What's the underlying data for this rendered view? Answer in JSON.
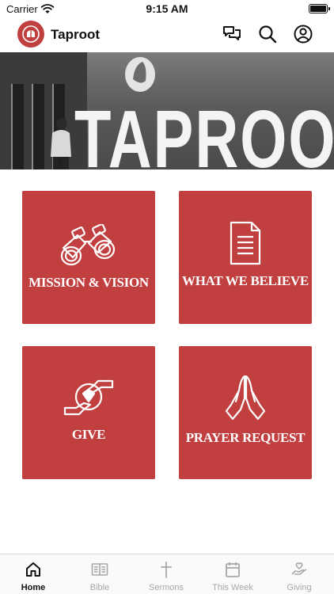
{
  "status_bar": {
    "carrier": "Carrier",
    "time": "9:15 AM"
  },
  "header": {
    "title": "Taproot",
    "actions": [
      {
        "icon": "chat-icon",
        "label": "Chat"
      },
      {
        "icon": "search-icon",
        "label": "Search"
      },
      {
        "icon": "account-icon",
        "label": "Account"
      }
    ]
  },
  "hero": {
    "sign_text": "TAPROOT"
  },
  "tiles": [
    {
      "label": "MISSION & VISION",
      "icon": "binoculars-icon"
    },
    {
      "label": "WHAT WE BELIEVE",
      "icon": "document-icon"
    },
    {
      "label": "GIVE",
      "icon": "giving-hands-icon"
    },
    {
      "label": "PRAYER REQUEST",
      "icon": "praying-hands-icon"
    }
  ],
  "tab_bar": [
    {
      "label": "Home",
      "icon": "home-icon",
      "active": true
    },
    {
      "label": "Bible",
      "icon": "bible-icon",
      "active": false
    },
    {
      "label": "Sermons",
      "icon": "cross-icon",
      "active": false
    },
    {
      "label": "This Week",
      "icon": "calendar-icon",
      "active": false
    },
    {
      "label": "Giving",
      "icon": "heart-hand-icon",
      "active": false
    }
  ],
  "colors": {
    "accent": "#c1403f",
    "tab_inactive": "#a7a7a7",
    "tab_active": "#111111"
  }
}
